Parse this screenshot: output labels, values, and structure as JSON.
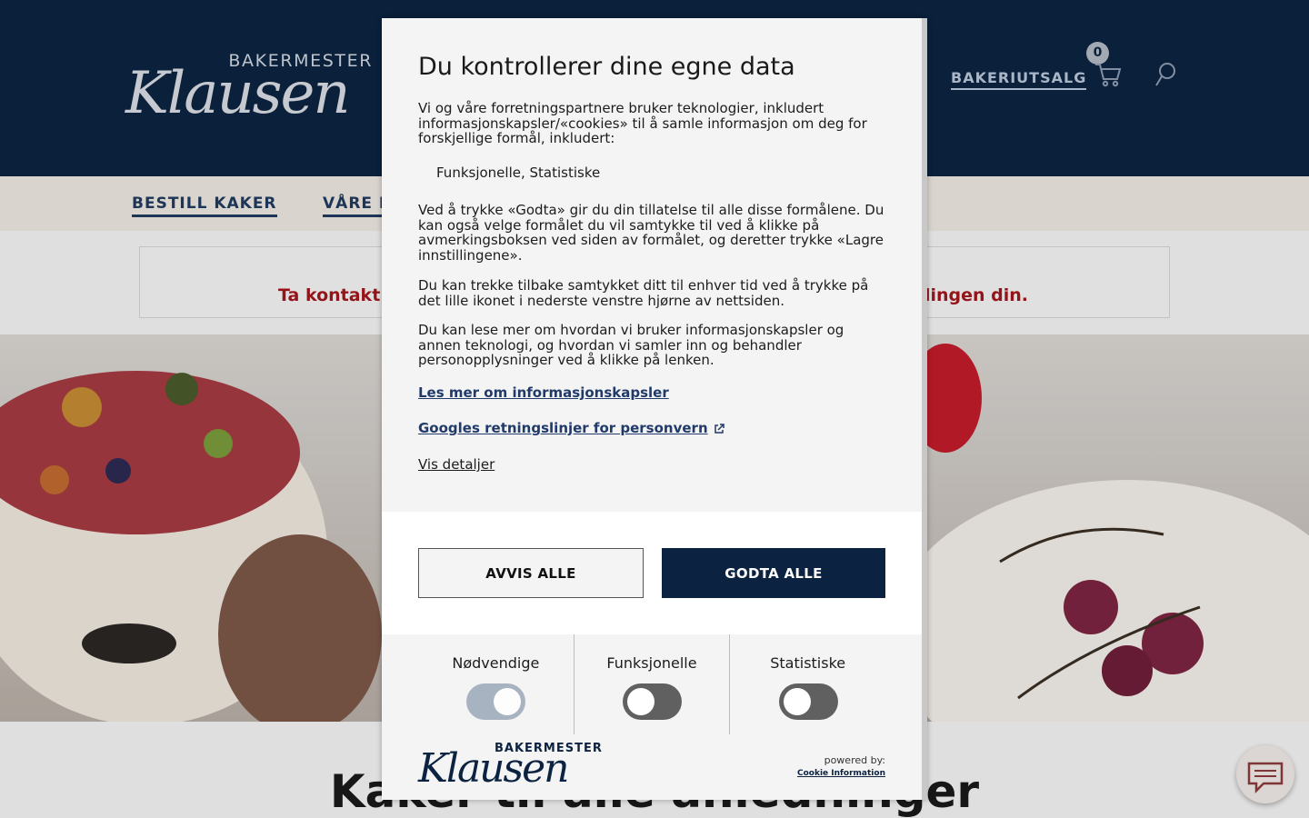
{
  "site": {
    "logo_small": "BAKERMESTER",
    "logo_script": "Klausen",
    "nav": [
      "BAKERIUTSALG"
    ],
    "cart_count": "0",
    "subnav": [
      "BESTILL KAKER",
      "VÅRE P"
    ],
    "notice_text": "Ta kontakt                                                                                                                   llingen din.",
    "hero_title": "Kaker til alle anledninger",
    "colors": {
      "header": "#0b2340",
      "accent": "#a0161c"
    }
  },
  "dialog": {
    "title": "Du kontrollerer dine egne data",
    "intro": "Vi og våre forretningspartnere bruker teknologier, inkludert informasjonskapsler/«cookies» til å samle informasjon om deg for forskjellige formål, inkludert:",
    "purposes": "Funksjonelle, Statistiske",
    "consent_text": "Ved å trykke «Godta» gir du din tillatelse til alle disse formålene. Du kan også velge formålet du vil samtykke til ved å klikke på avmerkingsboksen ved siden av formålet, og deretter trykke «Lagre innstillingene».",
    "withdraw_text": "Du kan trekke tilbake samtykket ditt til enhver tid ved å trykke på det lille ikonet i nederste venstre hjørne av nettsiden.",
    "more_text": "Du kan lese mer om hvordan vi bruker informasjonskapsler og annen teknologi, og hvordan vi samler inn og behandler personopplysninger ved å klikke på lenken.",
    "link_cookies": "Les mer om informasjonskapsler",
    "link_google": "Googles retningslinjer for personvern",
    "details": "Vis detaljer",
    "reject_label": "AVVIS ALLE",
    "accept_label": "GODTA ALLE",
    "toggles": [
      {
        "label": "Nødvendige",
        "on": true
      },
      {
        "label": "Funksjonelle",
        "on": false
      },
      {
        "label": "Statistiske",
        "on": false
      }
    ],
    "logo_small": "BAKERMESTER",
    "logo_script": "Klausen",
    "powered_by": "powered by:",
    "powered_link": "Cookie Information"
  },
  "icons": [
    "cart-icon",
    "search-icon",
    "external-link-icon",
    "chat-icon"
  ]
}
